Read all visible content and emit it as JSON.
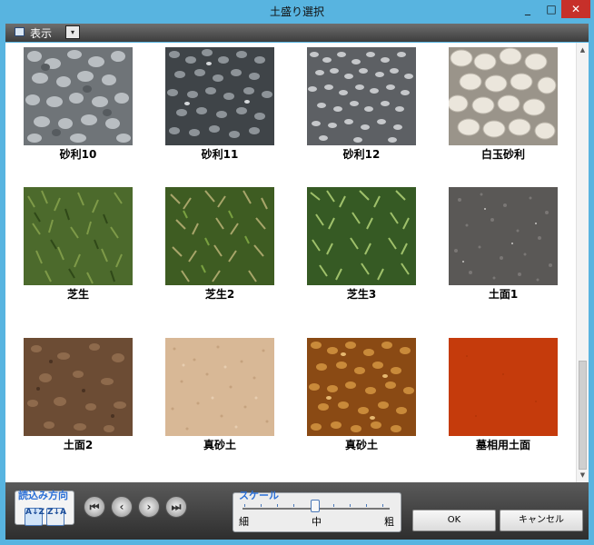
{
  "window": {
    "title": "土盛り選択",
    "minimize": "_",
    "maximize": "□",
    "close": "✕"
  },
  "toolbar": {
    "view_label": "表示",
    "dropdown_glyph": "▾"
  },
  "tiles": [
    {
      "label": "砂利10",
      "texture": "gray-gravel"
    },
    {
      "label": "砂利11",
      "texture": "dark-gravel"
    },
    {
      "label": "砂利12",
      "texture": "fine-gravel"
    },
    {
      "label": "白玉砂利",
      "texture": "white-pebbles"
    },
    {
      "label": "芝生",
      "texture": "grass"
    },
    {
      "label": "芝生2",
      "texture": "grass-dry"
    },
    {
      "label": "芝生3",
      "texture": "grass-bright"
    },
    {
      "label": "土面1",
      "texture": "gray-soil"
    },
    {
      "label": "土面2",
      "texture": "brown-soil"
    },
    {
      "label": "真砂土",
      "texture": "beige-sand"
    },
    {
      "label": "真砂土",
      "texture": "orange-gravel"
    },
    {
      "label": "墓相用土面",
      "texture": "red-soil"
    }
  ],
  "sort": {
    "label": "読込み方向",
    "asc_glyph": "A↓Z",
    "desc_glyph": "Z↓A"
  },
  "nav": {
    "first_glyph": "⏮",
    "prev_glyph": "‹",
    "next_glyph": "›",
    "last_glyph": "⏭"
  },
  "scale": {
    "label": "スケール",
    "fine": "細",
    "medium": "中",
    "coarse": "粗",
    "value_fraction": 0.5
  },
  "buttons": {
    "ok": "OK",
    "cancel": "キャンセル"
  },
  "colors": {
    "titlebar": "#58b4e0",
    "close": "#c7302a",
    "accent": "#2a6fd6"
  }
}
